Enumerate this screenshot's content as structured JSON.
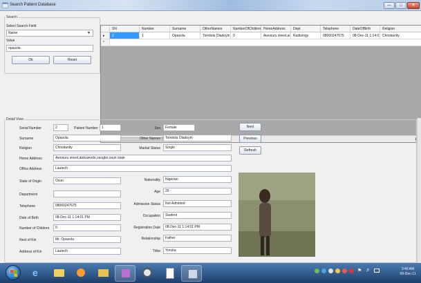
{
  "window": {
    "title": "Search Patient Database"
  },
  "search": {
    "group_label": "Search",
    "select_field_label": "Select Search Field",
    "selected_field": "Name",
    "value_label": "Value",
    "value": "opasola",
    "ok_label": "Ok",
    "reset_label": "Reset"
  },
  "grid": {
    "columns": [
      "SN",
      "Number",
      "Surname",
      "OtherNames",
      "NumberOfChildren",
      "HomeAddress",
      "Dept",
      "Telephone",
      "DateOfBirth",
      "Religion"
    ],
    "rows": [
      [
        "2",
        "1",
        "Opasola",
        "Tomilola Oladoyin",
        "0",
        "Awosuru street,al...",
        "Radiology",
        "08060247675",
        "08-Dec-11 1:14:0...",
        "Christianity"
      ]
    ],
    "new_row_marker": "*",
    "current_row_marker": "▸"
  },
  "detail": {
    "group_label": "Detail View",
    "serial_number_label": "Serial Number",
    "serial_number": "2",
    "patient_number_label": "Patient Number",
    "patient_number": "1",
    "surname_label": "Surname",
    "surname": "Opasola",
    "religion_label": "Religion",
    "religion": "Christianity",
    "home_address_label": "Home Address",
    "home_address": "Awosuru street,alekuwodo,osogbo,osun state",
    "office_address_label": "Office Address",
    "office_address": "Lautech",
    "state_of_origin_label": "State of Origin",
    "state_of_origin": "Osun",
    "department_label": "Department",
    "department": "",
    "telephone_label": "Telephone",
    "telephone": "08060247675",
    "date_of_birth_label": "Date of Birth",
    "date_of_birth": "08-Dec-11 1:14:01 PM",
    "number_of_children_label": "Number of Children",
    "number_of_children": "0",
    "next_of_kin_label": "Next of Kin",
    "next_of_kin": "Mr. Opasola",
    "address_of_kin_label": "Address of Kin",
    "address_of_kin": "Lautech",
    "sex_label": "Sex",
    "sex": "Female",
    "other_names_label": "Other Names",
    "other_names": "Tomilola Oladoym",
    "marital_status_label": "Marital Status",
    "marital_status": "Single",
    "nationality_label": "Nationality",
    "nationality": "Nigerian",
    "age_label": "Age",
    "age": "25",
    "admission_status_label": "Admission Status",
    "admission_status": "Not Admitted",
    "occupation_label": "Occupation",
    "occupation": "Student",
    "registration_date_label": "Registration Date",
    "registration_date": "08-Dec-11 1:14:01 PM",
    "relationship_label": "Relationship",
    "relationship": "Father",
    "tribe_label": "Tribe",
    "tribe": "Yoruba",
    "next_label": "Next",
    "previous_label": "Previous",
    "refresh_label": "Refresh"
  },
  "taskbar": {
    "clock_time": "3:40 AM",
    "clock_date": "09-Dec-11"
  },
  "colors": {
    "accent": "#3399ff",
    "taskbar": "#2a5589",
    "form_bg": "#f0f0f0"
  }
}
